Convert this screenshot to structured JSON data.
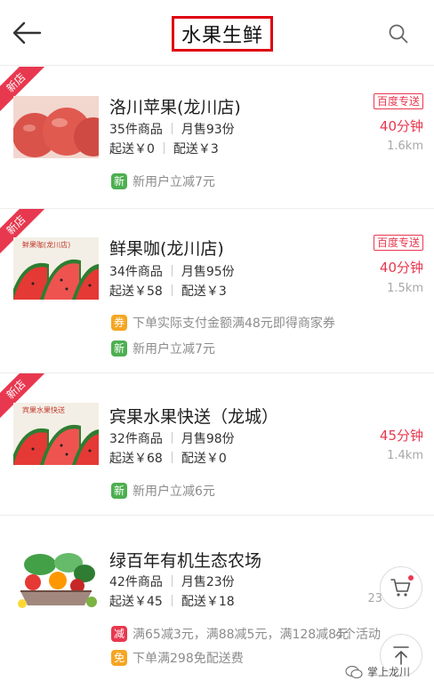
{
  "header": {
    "title": "水果生鲜",
    "back_icon": "arrow-left-icon",
    "search_icon": "search-icon"
  },
  "colors": {
    "accent": "#e8384f",
    "highlight_box": "#e0000e",
    "new_user_tag": "#4caf50",
    "coupon_tag": "#f5a623"
  },
  "stores": [
    {
      "ribbon": "新店",
      "name": "洛川苹果(龙川店)",
      "items": "35件商品",
      "monthly_sales": "月售93份",
      "min_order": "起送￥0",
      "delivery_fee": "配送￥3",
      "delivery_badge": "百度专送",
      "time": "40分钟",
      "distance": "1.6km",
      "promos": [
        {
          "tag": "新",
          "text": "新用户立减7元"
        }
      ]
    },
    {
      "ribbon": "新店",
      "name": "鲜果咖(龙川店)",
      "items": "34件商品",
      "monthly_sales": "月售95份",
      "min_order": "起送￥58",
      "delivery_fee": "配送￥3",
      "delivery_badge": "百度专送",
      "time": "40分钟",
      "distance": "1.5km",
      "promos": [
        {
          "tag": "券",
          "text": "下单实际支付金额满48元即得商家券"
        },
        {
          "tag": "新",
          "text": "新用户立减7元"
        }
      ]
    },
    {
      "ribbon": "新店",
      "name": "宾果水果快送（龙城）",
      "items": "32件商品",
      "monthly_sales": "月售98份",
      "min_order": "起送￥68",
      "delivery_fee": "配送￥0",
      "time": "45分钟",
      "distance": "1.4km",
      "promos": [
        {
          "tag": "新",
          "text": "新用户立减6元"
        }
      ]
    },
    {
      "name": "绿百年有机生态农场",
      "items": "42件商品",
      "monthly_sales": "月售23份",
      "min_order": "起送￥45",
      "delivery_fee": "配送￥18",
      "time_partial": "23",
      "activity_count": "4个活动",
      "promos": [
        {
          "tag": "减",
          "text": "满65减3元，满88减5元，满128减8元"
        },
        {
          "tag": "免",
          "text": "下单满298免配送费"
        }
      ]
    }
  ],
  "floating": {
    "cart_icon": "cart-icon",
    "top_icon": "back-to-top-icon"
  },
  "watermark": {
    "text": "掌上龙川",
    "icon": "wechat-icon"
  }
}
